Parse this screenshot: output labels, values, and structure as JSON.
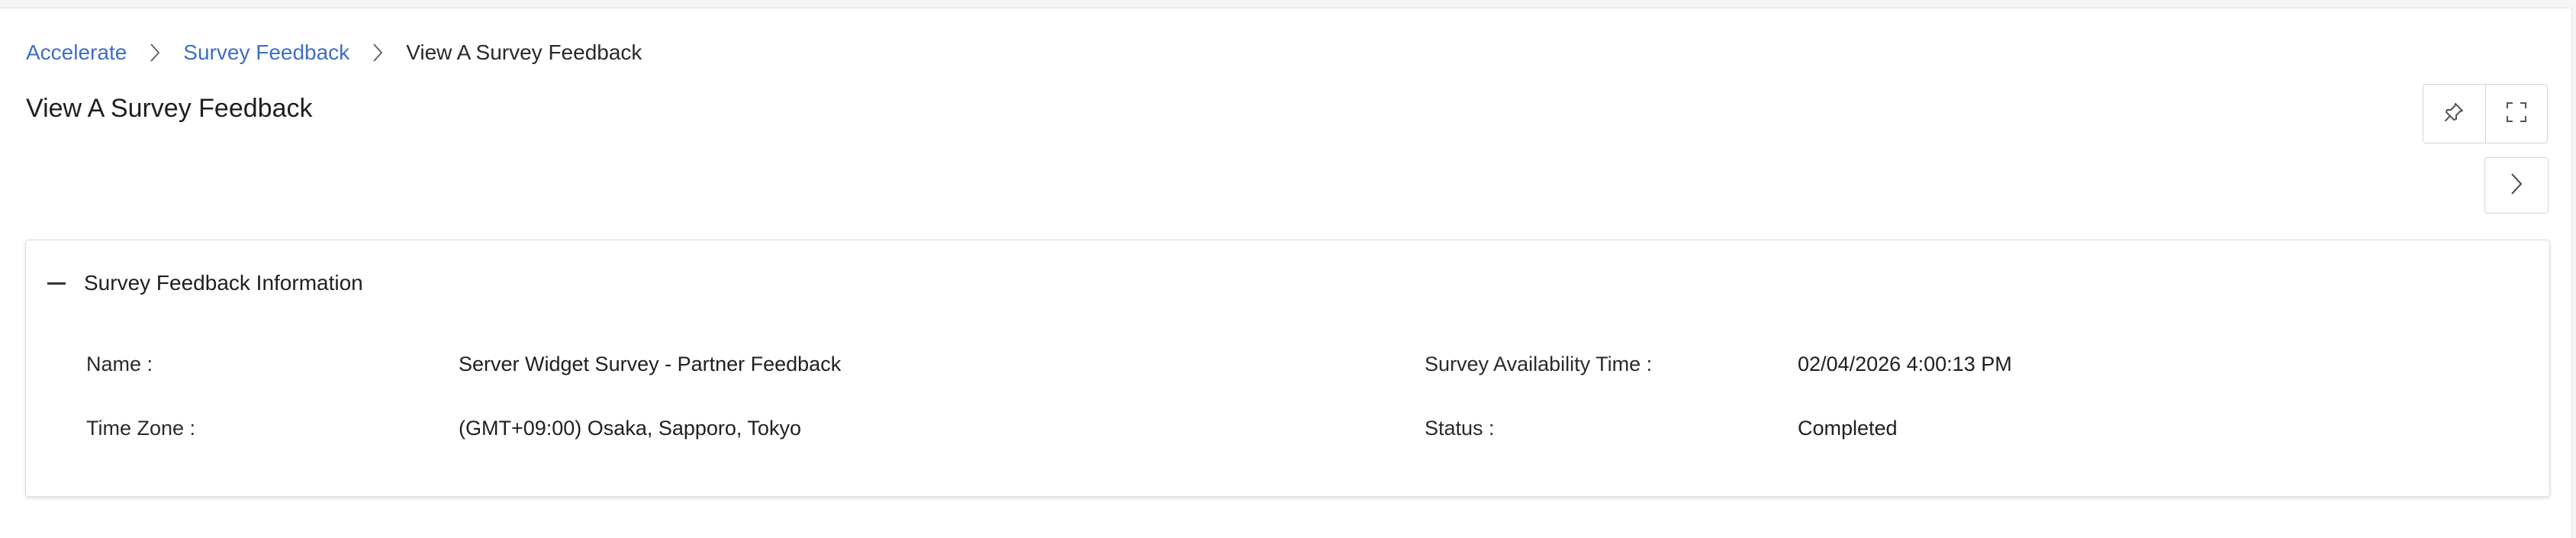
{
  "breadcrumb": {
    "items": [
      "Accelerate",
      "Survey Feedback",
      "View A Survey Feedback"
    ]
  },
  "page": {
    "title": "View A Survey Feedback"
  },
  "toolbar": {
    "icons": [
      "pin-icon",
      "fullscreen-icon",
      "chevron-right-icon"
    ]
  },
  "section": {
    "title": "Survey Feedback Information",
    "fields": {
      "name_label": "Name :",
      "name_value": "Server Widget Survey - Partner Feedback",
      "time_zone_label": "Time Zone :",
      "time_zone_value": "(GMT+09:00) Osaka, Sapporo, Tokyo",
      "availability_label": "Survey Availability Time :",
      "availability_value": "02/04/2026 4:00:13 PM",
      "status_label": "Status :",
      "status_value": "Completed"
    }
  },
  "colors": {
    "link": "#3e6ec7",
    "border": "#d6d6d6",
    "background": "#f4f5f7"
  }
}
